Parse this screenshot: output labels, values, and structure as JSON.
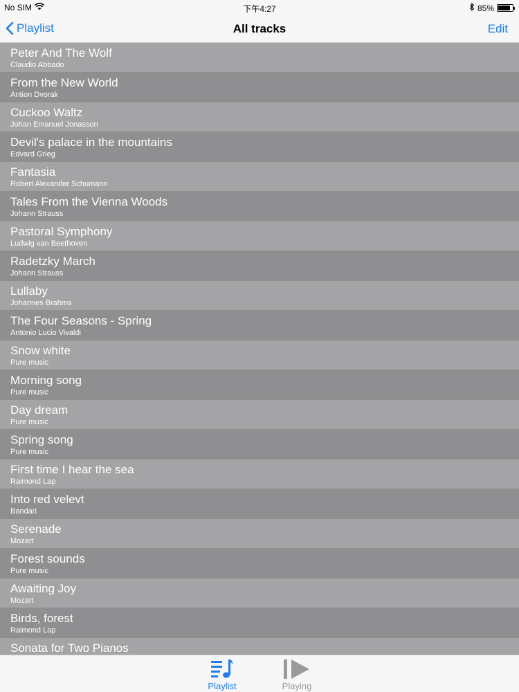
{
  "status": {
    "carrier": "No SIM",
    "time": "下午4:27",
    "battery": "85%",
    "battery_level": 0.85
  },
  "nav": {
    "back_label": "Playlist",
    "title": "All tracks",
    "edit_label": "Edit"
  },
  "tracks": [
    {
      "title": "Peter And The Wolf",
      "artist": "Claudio Abbado"
    },
    {
      "title": "From the New World",
      "artist": "Antion Dvorak"
    },
    {
      "title": "Cuckoo Waltz",
      "artist": "Johan Emanuel Jonasson"
    },
    {
      "title": "Devil's palace in the mountains",
      "artist": "Edvard Grieg"
    },
    {
      "title": "Fantasia",
      "artist": "Robert Alexander Schumann"
    },
    {
      "title": "Tales From the Vienna Woods",
      "artist": "Johann Strauss"
    },
    {
      "title": "Pastoral Symphony",
      "artist": "Ludwig van Beethoven"
    },
    {
      "title": "Radetzky March",
      "artist": "Johann Strauss"
    },
    {
      "title": "Lullaby",
      "artist": "Johannes Brahms"
    },
    {
      "title": "The Four Seasons - Spring",
      "artist": "Antonio Lucio Vivaldi"
    },
    {
      "title": "Snow white",
      "artist": "Pure music"
    },
    {
      "title": "Morning song",
      "artist": "Pure music"
    },
    {
      "title": "Day dream",
      "artist": "Pure music"
    },
    {
      "title": "Spring song",
      "artist": "Pure music"
    },
    {
      "title": "First time I hear the sea",
      "artist": "Raimond Lap"
    },
    {
      "title": "Into red velevt",
      "artist": "Bandari"
    },
    {
      "title": "Serenade",
      "artist": "Mozart"
    },
    {
      "title": "Forest sounds",
      "artist": "Pure music"
    },
    {
      "title": "Awaiting Joy",
      "artist": "Mozart"
    },
    {
      "title": "Birds, forest",
      "artist": "Raimond Lap"
    },
    {
      "title": "Sonata for Two Pianos",
      "artist": ""
    }
  ],
  "tabs": {
    "playlist_label": "Playlist",
    "playing_label": "Playing"
  },
  "colors": {
    "accent": "#1a7cf5",
    "row_light": "#a4a4a6",
    "row_dark": "#8f8f91",
    "inactive_tab": "#9a9a9a"
  },
  "icons": {
    "wifi": "wifi-icon",
    "bluetooth": "bluetooth-icon",
    "back": "chevron-left-icon",
    "playlist": "music-list-icon",
    "playing": "play-icon"
  }
}
